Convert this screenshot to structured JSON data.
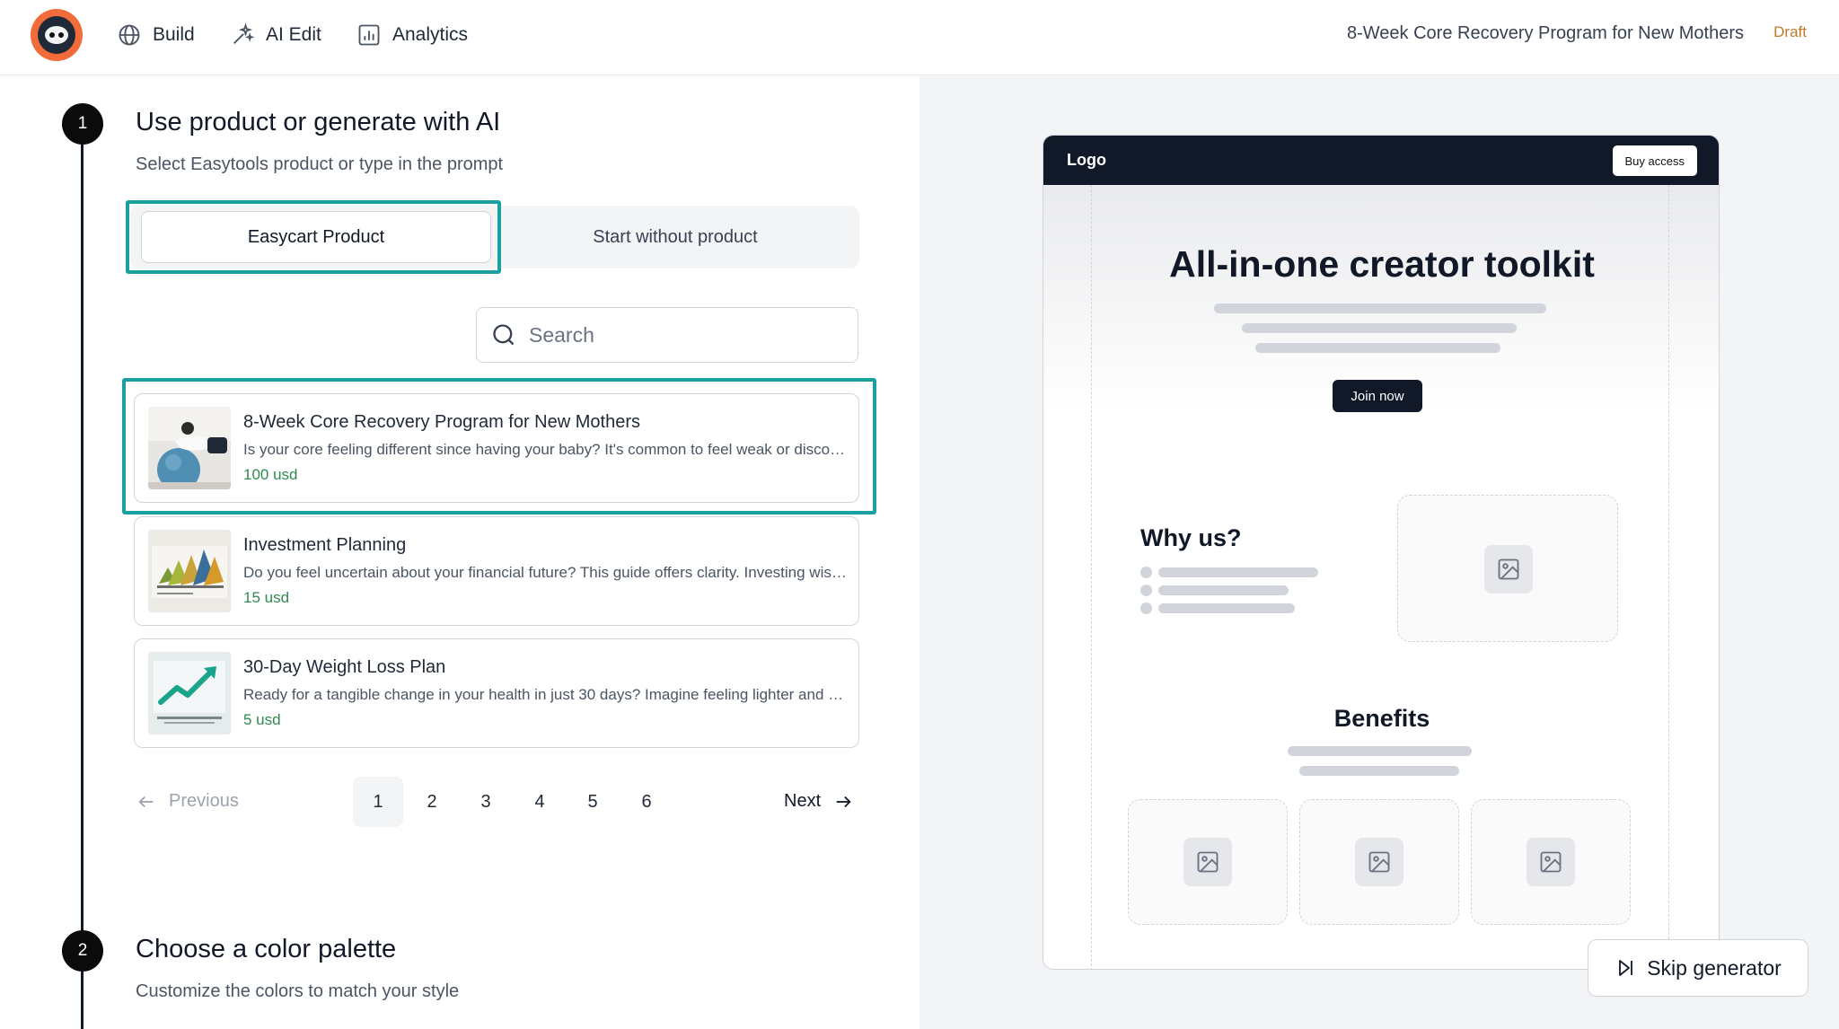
{
  "header": {
    "nav": [
      {
        "label": "Build",
        "icon": "globe-icon"
      },
      {
        "label": "AI Edit",
        "icon": "sparkle-wand-icon"
      },
      {
        "label": "Analytics",
        "icon": "bar-chart-icon"
      }
    ],
    "document_title": "8-Week Core Recovery Program for New Mothers",
    "status_badge": "Draft"
  },
  "steps": [
    {
      "number": "1",
      "title": "Use product or generate with AI",
      "subtitle": "Select Easytools product or type in the prompt"
    },
    {
      "number": "2",
      "title": "Choose a color palette",
      "subtitle": "Customize the colors to match your style"
    }
  ],
  "segmented": {
    "active": "Easycart Product",
    "inactive": "Start without product"
  },
  "search": {
    "placeholder": "Search",
    "value": ""
  },
  "products": [
    {
      "title": "8-Week Core Recovery Program for New Mothers",
      "description": "Is your core feeling different since having your baby? It's common to feel weak or disconnected after pregnancy.",
      "price": "100 usd",
      "selected": true
    },
    {
      "title": "Investment Planning",
      "description": "Do you feel uncertain about your financial future? This guide offers clarity. Investing wisely starts here.",
      "price": "15 usd",
      "selected": false
    },
    {
      "title": "30-Day Weight Loss Plan",
      "description": "Ready for a tangible change in your health in just 30 days? Imagine feeling lighter and more energetic.",
      "price": "5 usd",
      "selected": false
    }
  ],
  "pagination": {
    "previous": "Previous",
    "next": "Next",
    "pages": [
      "1",
      "2",
      "3",
      "4",
      "5",
      "6"
    ],
    "current": "1"
  },
  "preview": {
    "logo": "Logo",
    "buy_button": "Buy access",
    "hero_title": "All-in-one creator toolkit",
    "join_button": "Join now",
    "why_title": "Why us?",
    "benefits_title": "Benefits"
  },
  "skip_button": "Skip generator",
  "colors": {
    "accent_highlight": "#1aa0a0",
    "price_green": "#2f8a4f",
    "brand_orange": "#f26b3a",
    "draft_orange": "#c2782a"
  }
}
